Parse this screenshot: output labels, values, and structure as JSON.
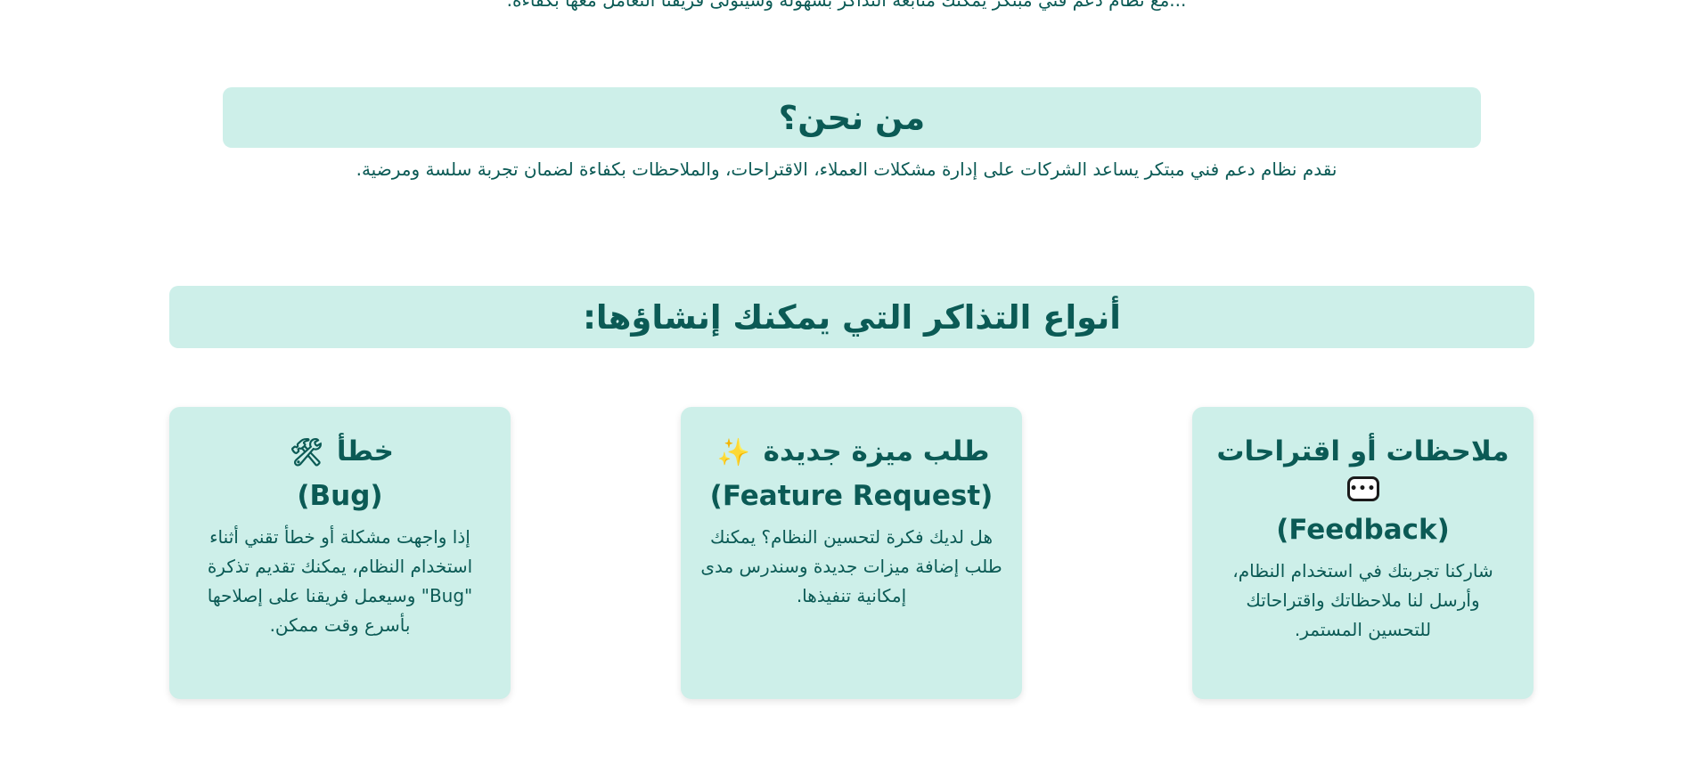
{
  "about": {
    "top_partial_text": "...مع نظام دعم فني مبتكر يمكنك متابعة التذاكر بسهولة وسيتولى فريقنا التعامل معها بكفاءة.",
    "title": "من نحن؟",
    "description": "نقدم نظام دعم فني مبتكر يساعد الشركات على إدارة مشكلات العملاء، الاقتراحات، والملاحظات بكفاءة لضمان تجربة سلسة ومرضية."
  },
  "ticket_types": {
    "title": "أنواع التذاكر التي يمكنك إنشاؤها:",
    "cards": [
      {
        "title": "ملاحظات أو اقتراحات",
        "subtitle": "(Feedback)",
        "icon": "speech-bubble-icon",
        "text": "شاركنا تجربتك في استخدام النظام، وأرسل لنا ملاحظاتك واقتراحاتك للتحسين المستمر."
      },
      {
        "title": "طلب ميزة جديدة",
        "subtitle": "(Feature Request)",
        "icon": "sparkles-icon",
        "icon_glyph": "✨",
        "text": "هل لديك فكرة لتحسين النظام؟ يمكنك طلب إضافة ميزات جديدة وسندرس مدى إمكانية تنفيذها."
      },
      {
        "title": "خطأ",
        "subtitle": "(Bug)",
        "icon": "tools-icon",
        "icon_glyph": "🛠",
        "text": "إذا واجهت مشكلة أو خطأ تقني أثناء استخدام النظام، يمكنك تقديم تذكرة \"Bug\" وسيعمل فريقنا على إصلاحها بأسرع وقت ممكن."
      }
    ]
  },
  "colors": {
    "accent_bg": "#cdefe9",
    "text": "#0b5a55"
  }
}
